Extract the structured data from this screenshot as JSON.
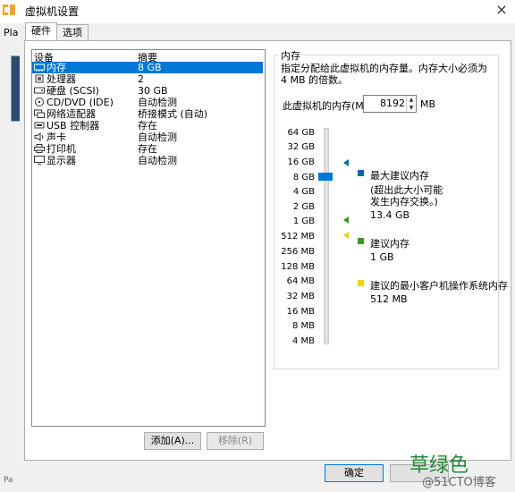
{
  "window": {
    "title": "虚拟机设置",
    "close_glyph": "×"
  },
  "background": {
    "left_text_top": "Pla",
    "left_text_bottom": "Pa"
  },
  "tabs": [
    {
      "label": "硬件",
      "active": true
    },
    {
      "label": "选项",
      "active": false
    }
  ],
  "device_list": {
    "header_device": "设备",
    "header_summary": "摘要",
    "rows": [
      {
        "icon": "memory-icon",
        "name": "内存",
        "summary": "8 GB",
        "selected": true
      },
      {
        "icon": "processor-icon",
        "name": "处理器",
        "summary": "2",
        "selected": false
      },
      {
        "icon": "hard-disk-icon",
        "name": "硬盘 (SCSI)",
        "summary": "30 GB",
        "selected": false
      },
      {
        "icon": "cd-dvd-icon",
        "name": "CD/DVD (IDE)",
        "summary": "自动检测",
        "selected": false
      },
      {
        "icon": "network-adapter-icon",
        "name": "网络适配器",
        "summary": "桥接模式 (自动)",
        "selected": false
      },
      {
        "icon": "usb-icon",
        "name": "USB 控制器",
        "summary": "存在",
        "selected": false
      },
      {
        "icon": "sound-card-icon",
        "name": "声卡",
        "summary": "自动检测",
        "selected": false
      },
      {
        "icon": "printer-icon",
        "name": "打印机",
        "summary": "存在",
        "selected": false
      },
      {
        "icon": "display-icon",
        "name": "显示器",
        "summary": "自动检测",
        "selected": false
      }
    ]
  },
  "buttons": {
    "add": "添加(A)...",
    "remove": "移除(R)",
    "ok": "确定",
    "cancel": ""
  },
  "memory_panel": {
    "group_title": "内存",
    "description": "指定分配给此虚拟机的内存量。内存大小必须为 4 MB 的倍数。",
    "field_label": "此虚拟机的内存(M):",
    "field_value": "8192",
    "unit": "MB",
    "scale": [
      "64 GB",
      "32 GB",
      "16 GB",
      "8 GB",
      "4 GB",
      "2 GB",
      "1 GB",
      "512 MB",
      "256 MB",
      "128 MB",
      "64 MB",
      "32 MB",
      "16 MB",
      "8 MB",
      "4 MB"
    ],
    "legend": {
      "max_title": "最大建议内存",
      "max_note": "(超出此大小可能发生内存交换。)",
      "max_value": "13.4 GB",
      "rec_title": "建议内存",
      "rec_value": "1 GB",
      "min_title": "建议的最小客户机操作系统内存",
      "min_value": "512 MB"
    },
    "colors": {
      "max": "#0067b8",
      "recommended": "#3a9a1f",
      "minimum": "#f5d300",
      "thumb": "#0078d7"
    }
  },
  "watermark": {
    "green_text": "草绿色",
    "site_text": "@51CTO博客"
  }
}
